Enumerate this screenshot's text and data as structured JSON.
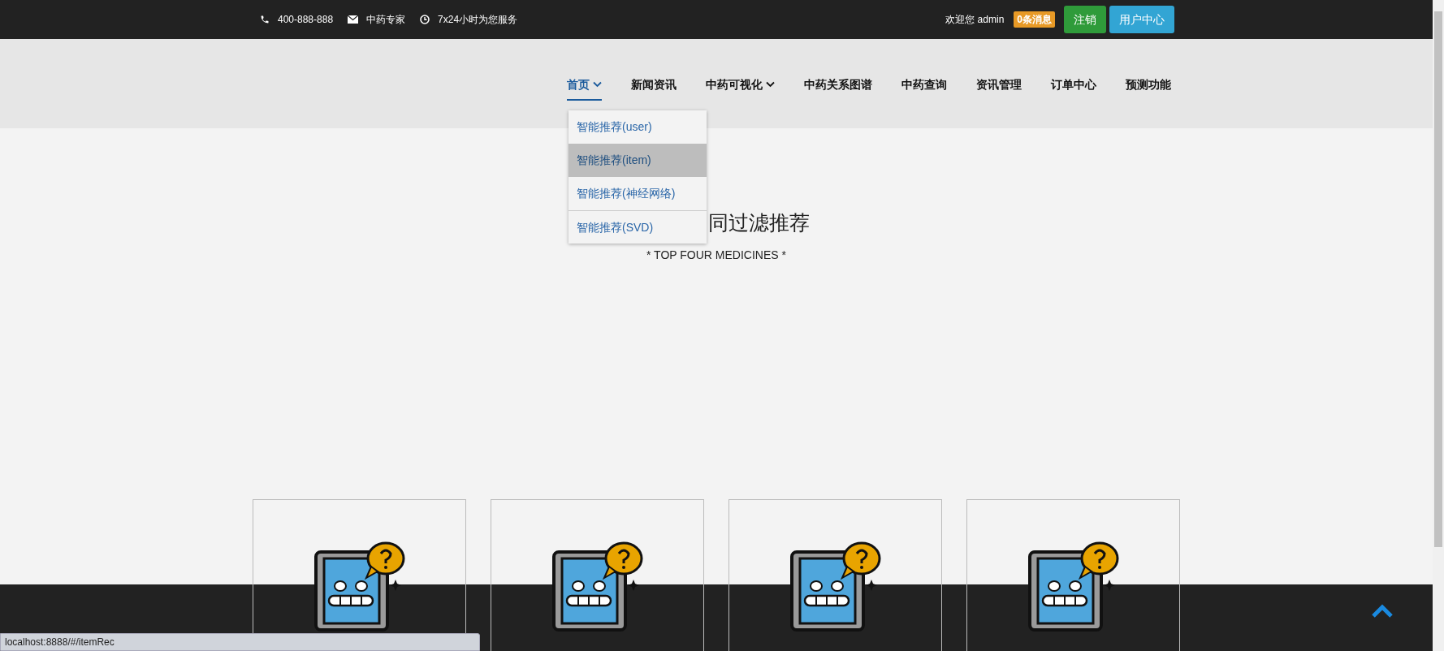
{
  "top_bar": {
    "phone": "400-888-888",
    "expert": "中药专家",
    "service": "7x24小时为您服务",
    "welcome": "欢迎您 admin",
    "messages_badge": "0条消息",
    "logout_button": "注销",
    "user_center_button": "用户中心"
  },
  "nav": {
    "items": [
      {
        "label": "首页",
        "selected": true,
        "dropdown": true
      },
      {
        "label": "新闻资讯",
        "selected": false,
        "dropdown": false
      },
      {
        "label": "中药可视化",
        "selected": false,
        "dropdown": true
      },
      {
        "label": "中药关系图谱",
        "selected": false,
        "dropdown": false
      },
      {
        "label": "中药查询",
        "selected": false,
        "dropdown": false
      },
      {
        "label": "资讯管理",
        "selected": false,
        "dropdown": false
      },
      {
        "label": "订单中心",
        "selected": false,
        "dropdown": false
      },
      {
        "label": "预测功能",
        "selected": false,
        "dropdown": false
      }
    ]
  },
  "dropdown_menu": {
    "items": [
      {
        "label": "智能推荐(user)",
        "hovered": false
      },
      {
        "label": "智能推荐(item)",
        "hovered": true
      },
      {
        "label": "智能推荐(神经网络)",
        "hovered": false
      },
      {
        "label": "智能推荐(SVD)",
        "hovered": false
      }
    ]
  },
  "section": {
    "title": "同过滤推荐",
    "subtitle": "* TOP FOUR MEDICINES *"
  },
  "cards": [
    {
      "kind": "placeholder"
    },
    {
      "kind": "placeholder"
    },
    {
      "kind": "placeholder"
    },
    {
      "kind": "placeholder"
    }
  ],
  "status_bar": {
    "url": "localhost:8888/#/itemRec"
  }
}
